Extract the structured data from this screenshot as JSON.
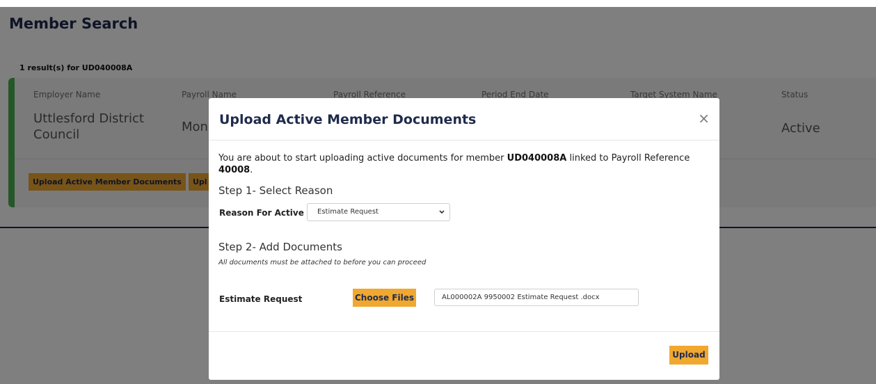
{
  "page": {
    "title": "Member Search",
    "result_count": "1 result(s) for UD040008A"
  },
  "results_table": {
    "columns": [
      "Employer Name",
      "Payroll Name",
      "Payroll Reference",
      "Period End Date",
      "Target System Name",
      "Status"
    ],
    "row": {
      "employer_name": "Uttlesford District Council",
      "employer_name_line1": "Uttlesford District",
      "employer_name_line2": "Council",
      "payroll_name_partial": "Mon",
      "status": "Active"
    },
    "actions": {
      "upload_active": "Upload Active Member Documents",
      "upload_other_partial": "Upl"
    }
  },
  "modal": {
    "title": "Upload Active Member Documents",
    "close": "×",
    "intro_part1": "You are about to start uploading active documents for member ",
    "member_id": "UD040008A",
    "intro_part2": " linked to Payroll Reference ",
    "payroll_reference": "40008",
    "intro_part3": ".",
    "step1_title": "Step 1- Select Reason",
    "reason_label": "Reason For Active",
    "reason_selected": "Estimate Request",
    "step2_title": "Step 2- Add Documents",
    "step2_note": "All documents must be attached to before you can proceed",
    "document_label": "Estimate Request",
    "choose_files": "Choose Files",
    "attached_file": "AL000002A 9950002 Estimate Request .docx",
    "upload": "Upload"
  },
  "colors": {
    "brand_navy": "#1f2b4c",
    "accent_amber": "#f0a830",
    "status_green": "#4caf50"
  }
}
